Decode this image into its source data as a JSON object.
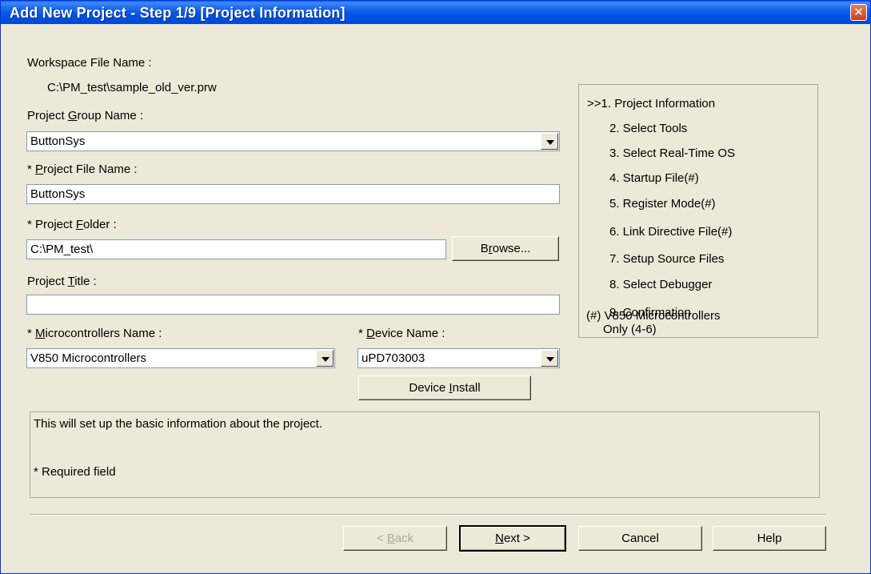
{
  "window": {
    "title": "Add New Project - Step 1/9 [Project Information]",
    "close_glyph": "✕"
  },
  "workspace": {
    "label": "Workspace File Name :",
    "value": "C:\\PM_test\\sample_old_ver.prw"
  },
  "project_group": {
    "label_pre": "Project ",
    "label_key": "G",
    "label_post": "roup Name :",
    "value": "ButtonSys"
  },
  "project_file": {
    "label_pre": "* ",
    "label_key": "P",
    "label_post": "roject File Name :",
    "value": "ButtonSys"
  },
  "project_folder": {
    "label_pre": "* Project ",
    "label_key": "F",
    "label_post": "older :",
    "value": "C:\\PM_test\\",
    "browse_pre": "B",
    "browse_key": "r",
    "browse_post": "owse..."
  },
  "project_title": {
    "label_pre": "Project ",
    "label_key": "T",
    "label_post": "itle :",
    "value": ""
  },
  "microcontrollers": {
    "label_pre": "* ",
    "label_key": "M",
    "label_post": "icrocontrollers Name :",
    "value": "V850 Microcontrollers"
  },
  "device": {
    "label_pre": "* ",
    "label_key": "D",
    "label_post": "evice Name :",
    "value": "uPD703003",
    "install_pre": "Device ",
    "install_key": "I",
    "install_post": "nstall"
  },
  "steps": [
    ">>1. Project Information",
    "2. Select Tools",
    "3. Select Real-Time OS",
    "4. Startup File(#)",
    "5. Register Mode(#)",
    "6. Link Directive File(#)",
    "7. Setup Source Files",
    "8. Select Debugger",
    "9. Confirmation"
  ],
  "steps_note": {
    "line1": "(#) V850 Microcontrollers",
    "line2": "Only (4-6)"
  },
  "description": {
    "line1": "This will set up the basic information about the project.",
    "line2": "* Required field"
  },
  "buttons": {
    "back_pre": "< ",
    "back_key": "B",
    "back_post": "ack",
    "next_key": "N",
    "next_post": "ext >",
    "cancel": "Cancel",
    "help": "Help"
  },
  "colors": {
    "titlebar": "#0054e3",
    "face": "#ece9d8",
    "field_border": "#7f9db9",
    "disabled_text": "#aca899"
  }
}
